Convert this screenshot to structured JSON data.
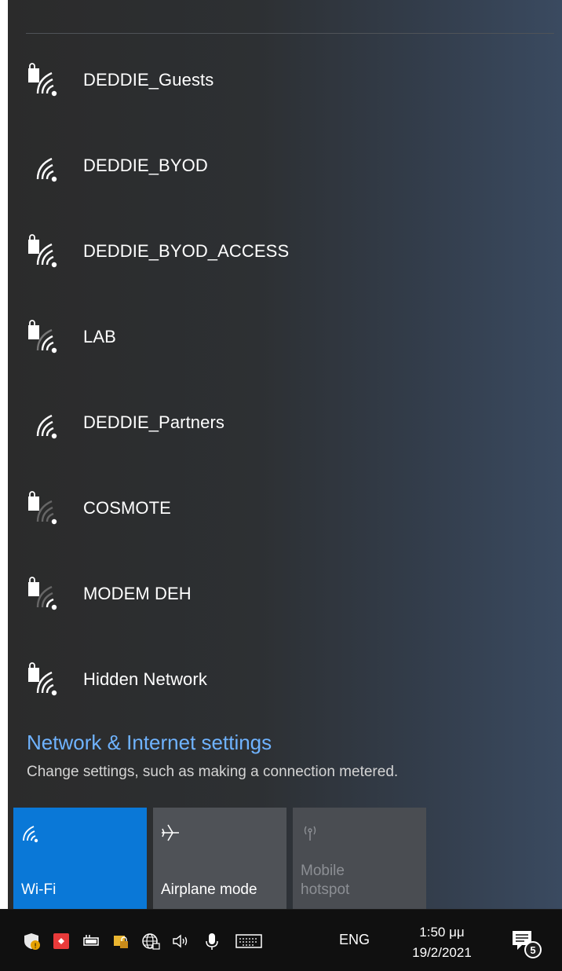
{
  "networks": [
    {
      "name": "DEDDIE_Guests",
      "secured": true
    },
    {
      "name": "DEDDIE_BYOD",
      "secured": false
    },
    {
      "name": "DEDDIE_BYOD_ACCESS",
      "secured": true
    },
    {
      "name": "LAB",
      "secured": true
    },
    {
      "name": "DEDDIE_Partners",
      "secured": false
    },
    {
      "name": "COSMOTE",
      "secured": true
    },
    {
      "name": "MODEM DEH",
      "secured": true
    },
    {
      "name": "Hidden Network",
      "secured": true
    }
  ],
  "settings": {
    "link": "Network & Internet settings",
    "description": "Change settings, such as making a connection metered."
  },
  "quick_actions": [
    {
      "label": "Wi-Fi",
      "icon": "wifi-icon",
      "state": "on"
    },
    {
      "label": "Airplane mode",
      "icon": "airplane-icon",
      "state": "off"
    },
    {
      "label": "Mobile hotspot",
      "icon": "hotspot-icon",
      "state": "disabled"
    }
  ],
  "taskbar": {
    "language": "ENG",
    "time": "1:50 μμ",
    "date": "19/2/2021",
    "notification_count": "5"
  },
  "colors": {
    "accent": "#0a78d7",
    "link": "#6fb3ff"
  }
}
